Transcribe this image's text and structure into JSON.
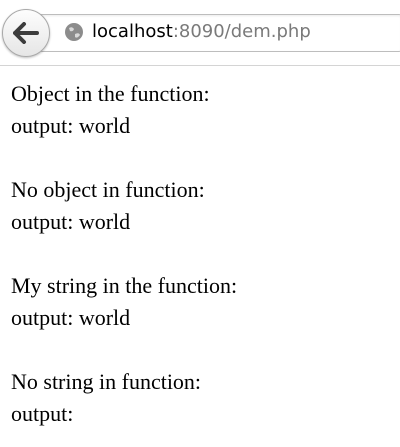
{
  "browser": {
    "url_host": "localhost",
    "url_rest": ":8090/dem.php",
    "icons": {
      "back": "back-arrow-icon",
      "site": "globe-icon"
    }
  },
  "content": {
    "lines": [
      "Object in the function:",
      "output: world",
      "",
      "No object in function:",
      "output: world",
      "",
      "My string in the function:",
      "output: world",
      "",
      "No string in function:",
      "output:"
    ]
  }
}
